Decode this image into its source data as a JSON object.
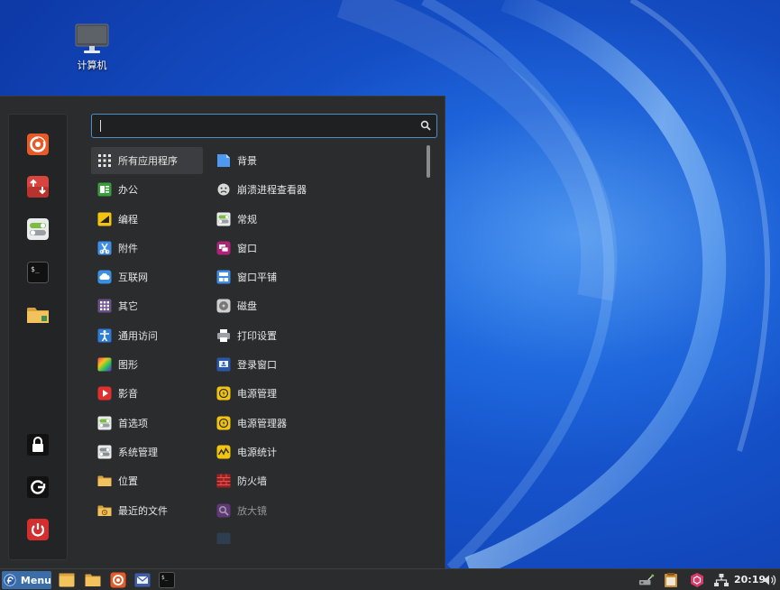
{
  "desktop": {
    "icons": [
      {
        "label": "计算机",
        "icon": "monitor-icon"
      }
    ]
  },
  "menu": {
    "search": {
      "value": "",
      "placeholder": ""
    },
    "favorites": [
      {
        "name": "firefox",
        "icon": "firefox-icon"
      },
      {
        "name": "software-manager",
        "icon": "software-manager-icon"
      },
      {
        "name": "settings",
        "icon": "settings-toggle-icon"
      },
      {
        "name": "terminal",
        "icon": "terminal-icon"
      },
      {
        "name": "files",
        "icon": "folder-icon"
      }
    ],
    "session": [
      {
        "name": "lock-screen",
        "icon": "lock-icon"
      },
      {
        "name": "logout",
        "icon": "logout-icon"
      },
      {
        "name": "shutdown",
        "icon": "power-icon"
      }
    ],
    "categories": [
      {
        "label": "所有应用程序",
        "icon": "grid-icon",
        "selected": true
      },
      {
        "label": "办公",
        "icon": "office-icon"
      },
      {
        "label": "编程",
        "icon": "programming-icon"
      },
      {
        "label": "附件",
        "icon": "accessories-icon"
      },
      {
        "label": "互联网",
        "icon": "internet-cloud-icon"
      },
      {
        "label": "其它",
        "icon": "other-icon"
      },
      {
        "label": "通用访问",
        "icon": "accessibility-icon"
      },
      {
        "label": "图形",
        "icon": "graphics-icon"
      },
      {
        "label": "影音",
        "icon": "multimedia-icon"
      },
      {
        "label": "首选项",
        "icon": "preferences-icon"
      },
      {
        "label": "系统管理",
        "icon": "administration-icon"
      },
      {
        "label": "位置",
        "icon": "places-folder-icon"
      },
      {
        "label": "最近的文件",
        "icon": "recent-files-icon"
      }
    ],
    "apps": [
      {
        "label": "背景",
        "icon": "background-icon"
      },
      {
        "label": "崩溃进程查看器",
        "icon": "crash-face-icon"
      },
      {
        "label": "常规",
        "icon": "general-toggle-icon"
      },
      {
        "label": "窗口",
        "icon": "windows-icon"
      },
      {
        "label": "窗口平铺",
        "icon": "window-tiling-icon"
      },
      {
        "label": "磁盘",
        "icon": "disks-icon"
      },
      {
        "label": "打印设置",
        "icon": "printer-icon"
      },
      {
        "label": "登录窗口",
        "icon": "login-window-icon"
      },
      {
        "label": "电源管理",
        "icon": "power-management-icon"
      },
      {
        "label": "电源管理器",
        "icon": "power-manager-icon"
      },
      {
        "label": "电源统计",
        "icon": "power-statistics-icon"
      },
      {
        "label": "防火墙",
        "icon": "firewall-icon"
      },
      {
        "label": "放大镜",
        "icon": "magnifier-icon"
      }
    ]
  },
  "panel": {
    "menu_label": "Menu",
    "launchers": [
      {
        "name": "show-desktop",
        "icon": "show-desktop-icon"
      },
      {
        "name": "files",
        "icon": "folder-icon"
      },
      {
        "name": "firefox",
        "icon": "firefox-icon"
      },
      {
        "name": "mail",
        "icon": "mail-icon"
      },
      {
        "name": "terminal",
        "icon": "terminal-icon"
      }
    ],
    "tray": [
      {
        "name": "network-manager",
        "icon": "network-wired-icon"
      },
      {
        "name": "clipboard",
        "icon": "clipboard-icon"
      },
      {
        "name": "update-manager",
        "icon": "shield-update-icon"
      },
      {
        "name": "network",
        "icon": "network-icon"
      }
    ],
    "clock": "20:19",
    "volume_icon": "volume-icon"
  },
  "colors": {
    "menu_bg": "#2b2c2e",
    "accent": "#4a8fc8",
    "desktop_blue": "#1550c8"
  }
}
